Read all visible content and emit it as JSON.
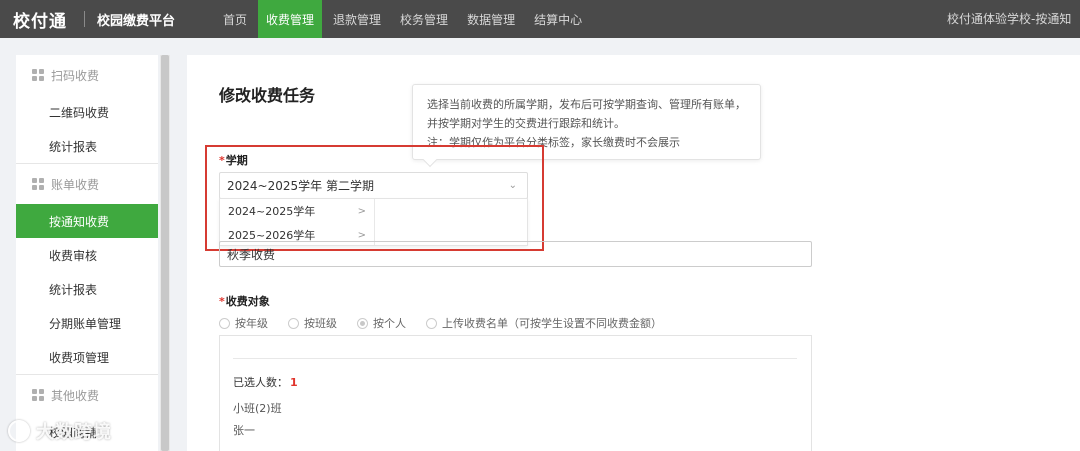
{
  "topbar": {
    "logo": "校付通",
    "platform_name": "校园缴费平台",
    "nav": [
      "首页",
      "收费管理",
      "退款管理",
      "校务管理",
      "数据管理",
      "结算中心"
    ],
    "active_nav": "收费管理",
    "school": "校付通体验学校-按通知..."
  },
  "sidebar": {
    "groups": [
      {
        "title": "扫码收费",
        "items": [
          "二维码收费",
          "统计报表"
        ]
      },
      {
        "title": "账单收费",
        "items": [
          "按通知收费",
          "收费审核",
          "统计报表",
          "分期账单管理",
          "收费项管理"
        ]
      },
      {
        "title": "其他收费",
        "items": [
          "校园商铺"
        ]
      }
    ],
    "active_item": "按通知收费"
  },
  "main": {
    "page_title": "修改收费任务",
    "tooltip": {
      "line1": "选择当前收费的所属学期，发布后可按学期查询、管理所有账单，",
      "line2": "并按学期对学生的交费进行跟踪和统计。",
      "line3": "注：学期仅作为平台分类标签，家长缴费时不会展示"
    },
    "term": {
      "required_mark": "*",
      "label": "学期",
      "value": "2024~2025学年 第二学期",
      "options": [
        "2024~2025学年",
        "2025~2026学年"
      ]
    },
    "name_input": {
      "value": "秋季收费"
    },
    "target": {
      "required_mark": "*",
      "label": "收费对象",
      "options": [
        "按年级",
        "按班级",
        "按个人",
        "上传收费名单（可按学生设置不同收费金额）"
      ],
      "selected": "按个人"
    },
    "selection": {
      "count_label": "已选人数：",
      "count": "1",
      "class_name": "小班(2)班",
      "student": "张一"
    }
  },
  "watermark": "大数跨境",
  "colors": {
    "accent": "#3fa93f",
    "topbar": "#4a4a4a",
    "highlight_box": "#d63b32",
    "required": "#e0342c"
  }
}
